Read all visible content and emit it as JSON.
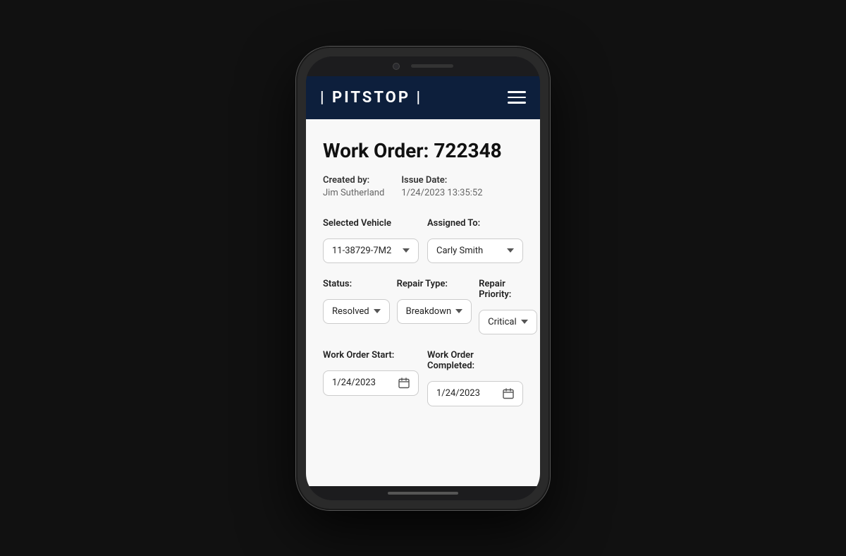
{
  "app": {
    "logo_text": "| PITSTOP |",
    "header_bg": "#0d1f3c"
  },
  "work_order": {
    "title": "Work Order: 722348",
    "created_by_label": "Created by:",
    "created_by_value": "Jim Sutherland",
    "issue_date_label": "Issue Date:",
    "issue_date_value": "1/24/2023 13:35:52",
    "selected_vehicle_label": "Selected Vehicle",
    "selected_vehicle_value": "11-38729-7M2",
    "assigned_to_label": "Assigned To:",
    "assigned_to_value": "Carly Smith",
    "status_label": "Status:",
    "status_value": "Resolved",
    "repair_type_label": "Repair Type:",
    "repair_type_value": "Breakdown",
    "repair_priority_label": "Repair Priority:",
    "repair_priority_value": "Critical",
    "work_order_start_label": "Work Order Start:",
    "work_order_start_value": "1/24/2023",
    "work_order_completed_label": "Work Order Completed:",
    "work_order_completed_value": "1/24/2023"
  }
}
